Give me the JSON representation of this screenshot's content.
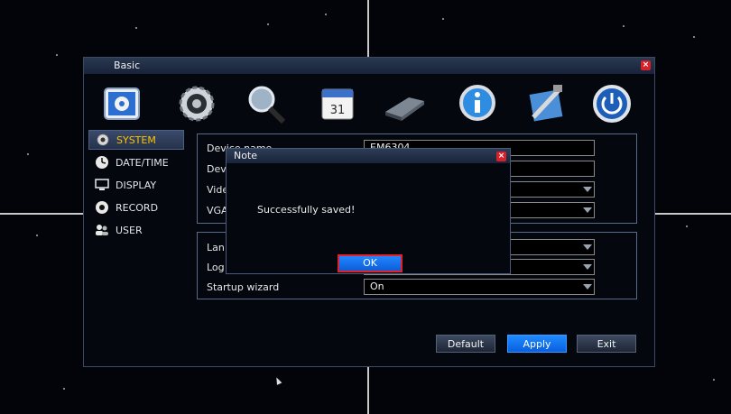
{
  "window": {
    "title": "Basic"
  },
  "toolbar": {
    "icons": [
      "system-settings-icon",
      "settings-gear-icon",
      "search-magnifier-icon",
      "calendar-icon",
      "hard-disk-icon",
      "info-icon",
      "tools-icon",
      "power-icon"
    ]
  },
  "sidebar": {
    "items": [
      {
        "label": "SYSTEM",
        "icon": "gear-icon",
        "active": true
      },
      {
        "label": "DATE/TIME",
        "icon": "clock-icon",
        "active": false
      },
      {
        "label": "DISPLAY",
        "icon": "monitor-icon",
        "active": false
      },
      {
        "label": "RECORD",
        "icon": "record-icon",
        "active": false
      },
      {
        "label": "USER",
        "icon": "users-icon",
        "active": false
      }
    ]
  },
  "form": {
    "device_name_label": "Device name",
    "device_name_value": "EM6304",
    "device_id_label": "Dev",
    "video_label": "Vide",
    "vga_label": "VGA",
    "language_label": "Lan",
    "logout_label": "Log",
    "startup_wizard_label": "Startup wizard",
    "startup_wizard_value": "On"
  },
  "buttons": {
    "default": "Default",
    "apply": "Apply",
    "exit": "Exit"
  },
  "note": {
    "title": "Note",
    "message": "Successfully saved!",
    "ok": "OK",
    "close": "×"
  },
  "colors": {
    "accent_yellow": "#ffc400",
    "button_blue": "#1f8bff",
    "close_red": "#d8202a"
  }
}
